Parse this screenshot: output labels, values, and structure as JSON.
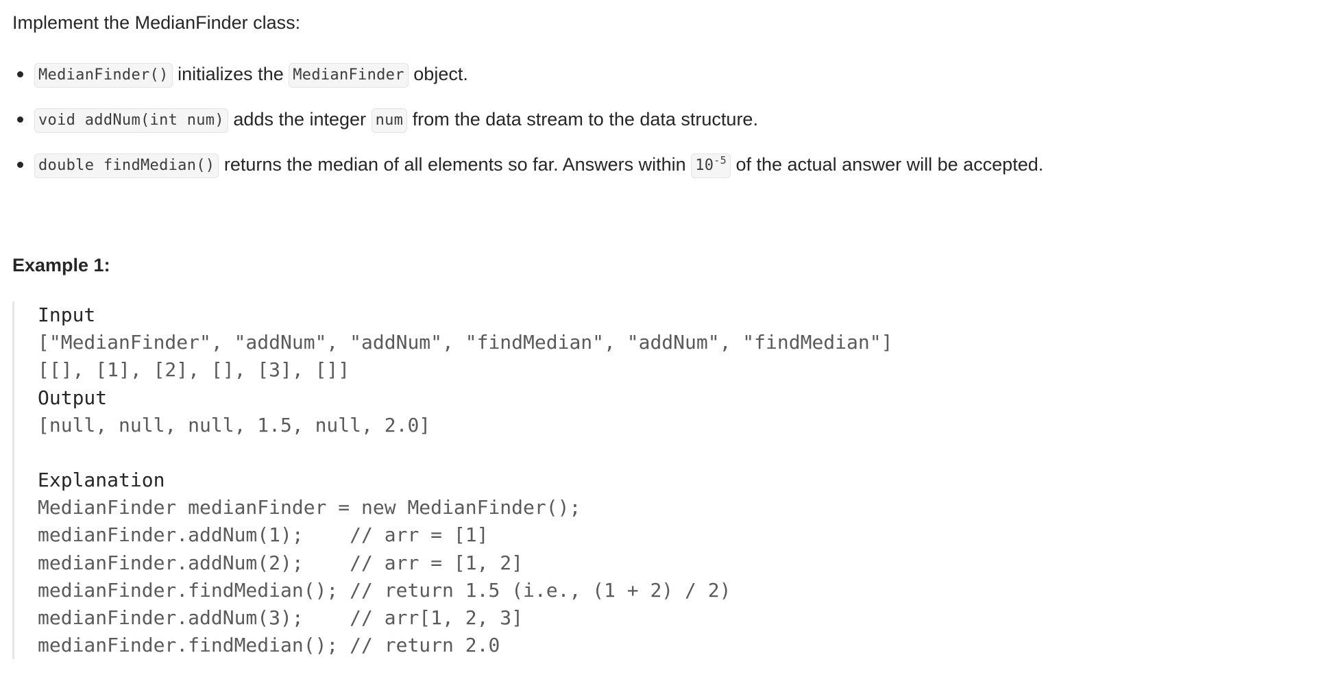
{
  "intro": "Implement the MedianFinder class:",
  "bullets": [
    {
      "code1": "MedianFinder()",
      "text1": " initializes the ",
      "code2": "MedianFinder",
      "text2": " object."
    },
    {
      "code1": "void addNum(int num)",
      "text1": " adds the integer ",
      "code2": "num",
      "text2": " from the data stream to the data structure."
    },
    {
      "code1": "double findMedian()",
      "text1": " returns the median of all elements so far. Answers within ",
      "code2_base": "10",
      "code2_sup": "-5",
      "text2": " of the actual answer will be accepted."
    }
  ],
  "example": {
    "title": "Example 1:",
    "input_label": "Input",
    "input_line1": "[\"MedianFinder\", \"addNum\", \"addNum\", \"findMedian\", \"addNum\", \"findMedian\"]",
    "input_line2": "[[], [1], [2], [], [3], []]",
    "output_label": "Output",
    "output_line": "[null, null, null, 1.5, null, 2.0]",
    "explanation_label": "Explanation",
    "explanation_lines": [
      "MedianFinder medianFinder = new MedianFinder();",
      "medianFinder.addNum(1);    // arr = [1]",
      "medianFinder.addNum(2);    // arr = [1, 2]",
      "medianFinder.findMedian(); // return 1.5 (i.e., (1 + 2) / 2)",
      "medianFinder.addNum(3);    // arr[1, 2, 3]",
      "medianFinder.findMedian(); // return 2.0"
    ]
  }
}
